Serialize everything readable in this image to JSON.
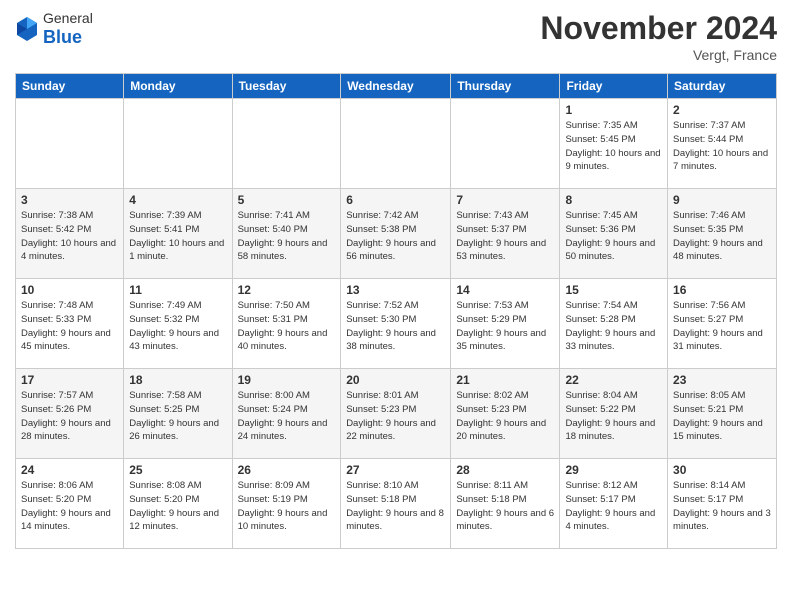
{
  "logo": {
    "general": "General",
    "blue": "Blue"
  },
  "title": "November 2024",
  "location": "Vergt, France",
  "days_header": [
    "Sunday",
    "Monday",
    "Tuesday",
    "Wednesday",
    "Thursday",
    "Friday",
    "Saturday"
  ],
  "weeks": [
    [
      {
        "day": "",
        "info": ""
      },
      {
        "day": "",
        "info": ""
      },
      {
        "day": "",
        "info": ""
      },
      {
        "day": "",
        "info": ""
      },
      {
        "day": "",
        "info": ""
      },
      {
        "day": "1",
        "info": "Sunrise: 7:35 AM\nSunset: 5:45 PM\nDaylight: 10 hours and 9 minutes."
      },
      {
        "day": "2",
        "info": "Sunrise: 7:37 AM\nSunset: 5:44 PM\nDaylight: 10 hours and 7 minutes."
      }
    ],
    [
      {
        "day": "3",
        "info": "Sunrise: 7:38 AM\nSunset: 5:42 PM\nDaylight: 10 hours and 4 minutes."
      },
      {
        "day": "4",
        "info": "Sunrise: 7:39 AM\nSunset: 5:41 PM\nDaylight: 10 hours and 1 minute."
      },
      {
        "day": "5",
        "info": "Sunrise: 7:41 AM\nSunset: 5:40 PM\nDaylight: 9 hours and 58 minutes."
      },
      {
        "day": "6",
        "info": "Sunrise: 7:42 AM\nSunset: 5:38 PM\nDaylight: 9 hours and 56 minutes."
      },
      {
        "day": "7",
        "info": "Sunrise: 7:43 AM\nSunset: 5:37 PM\nDaylight: 9 hours and 53 minutes."
      },
      {
        "day": "8",
        "info": "Sunrise: 7:45 AM\nSunset: 5:36 PM\nDaylight: 9 hours and 50 minutes."
      },
      {
        "day": "9",
        "info": "Sunrise: 7:46 AM\nSunset: 5:35 PM\nDaylight: 9 hours and 48 minutes."
      }
    ],
    [
      {
        "day": "10",
        "info": "Sunrise: 7:48 AM\nSunset: 5:33 PM\nDaylight: 9 hours and 45 minutes."
      },
      {
        "day": "11",
        "info": "Sunrise: 7:49 AM\nSunset: 5:32 PM\nDaylight: 9 hours and 43 minutes."
      },
      {
        "day": "12",
        "info": "Sunrise: 7:50 AM\nSunset: 5:31 PM\nDaylight: 9 hours and 40 minutes."
      },
      {
        "day": "13",
        "info": "Sunrise: 7:52 AM\nSunset: 5:30 PM\nDaylight: 9 hours and 38 minutes."
      },
      {
        "day": "14",
        "info": "Sunrise: 7:53 AM\nSunset: 5:29 PM\nDaylight: 9 hours and 35 minutes."
      },
      {
        "day": "15",
        "info": "Sunrise: 7:54 AM\nSunset: 5:28 PM\nDaylight: 9 hours and 33 minutes."
      },
      {
        "day": "16",
        "info": "Sunrise: 7:56 AM\nSunset: 5:27 PM\nDaylight: 9 hours and 31 minutes."
      }
    ],
    [
      {
        "day": "17",
        "info": "Sunrise: 7:57 AM\nSunset: 5:26 PM\nDaylight: 9 hours and 28 minutes."
      },
      {
        "day": "18",
        "info": "Sunrise: 7:58 AM\nSunset: 5:25 PM\nDaylight: 9 hours and 26 minutes."
      },
      {
        "day": "19",
        "info": "Sunrise: 8:00 AM\nSunset: 5:24 PM\nDaylight: 9 hours and 24 minutes."
      },
      {
        "day": "20",
        "info": "Sunrise: 8:01 AM\nSunset: 5:23 PM\nDaylight: 9 hours and 22 minutes."
      },
      {
        "day": "21",
        "info": "Sunrise: 8:02 AM\nSunset: 5:23 PM\nDaylight: 9 hours and 20 minutes."
      },
      {
        "day": "22",
        "info": "Sunrise: 8:04 AM\nSunset: 5:22 PM\nDaylight: 9 hours and 18 minutes."
      },
      {
        "day": "23",
        "info": "Sunrise: 8:05 AM\nSunset: 5:21 PM\nDaylight: 9 hours and 15 minutes."
      }
    ],
    [
      {
        "day": "24",
        "info": "Sunrise: 8:06 AM\nSunset: 5:20 PM\nDaylight: 9 hours and 14 minutes."
      },
      {
        "day": "25",
        "info": "Sunrise: 8:08 AM\nSunset: 5:20 PM\nDaylight: 9 hours and 12 minutes."
      },
      {
        "day": "26",
        "info": "Sunrise: 8:09 AM\nSunset: 5:19 PM\nDaylight: 9 hours and 10 minutes."
      },
      {
        "day": "27",
        "info": "Sunrise: 8:10 AM\nSunset: 5:18 PM\nDaylight: 9 hours and 8 minutes."
      },
      {
        "day": "28",
        "info": "Sunrise: 8:11 AM\nSunset: 5:18 PM\nDaylight: 9 hours and 6 minutes."
      },
      {
        "day": "29",
        "info": "Sunrise: 8:12 AM\nSunset: 5:17 PM\nDaylight: 9 hours and 4 minutes."
      },
      {
        "day": "30",
        "info": "Sunrise: 8:14 AM\nSunset: 5:17 PM\nDaylight: 9 hours and 3 minutes."
      }
    ]
  ]
}
